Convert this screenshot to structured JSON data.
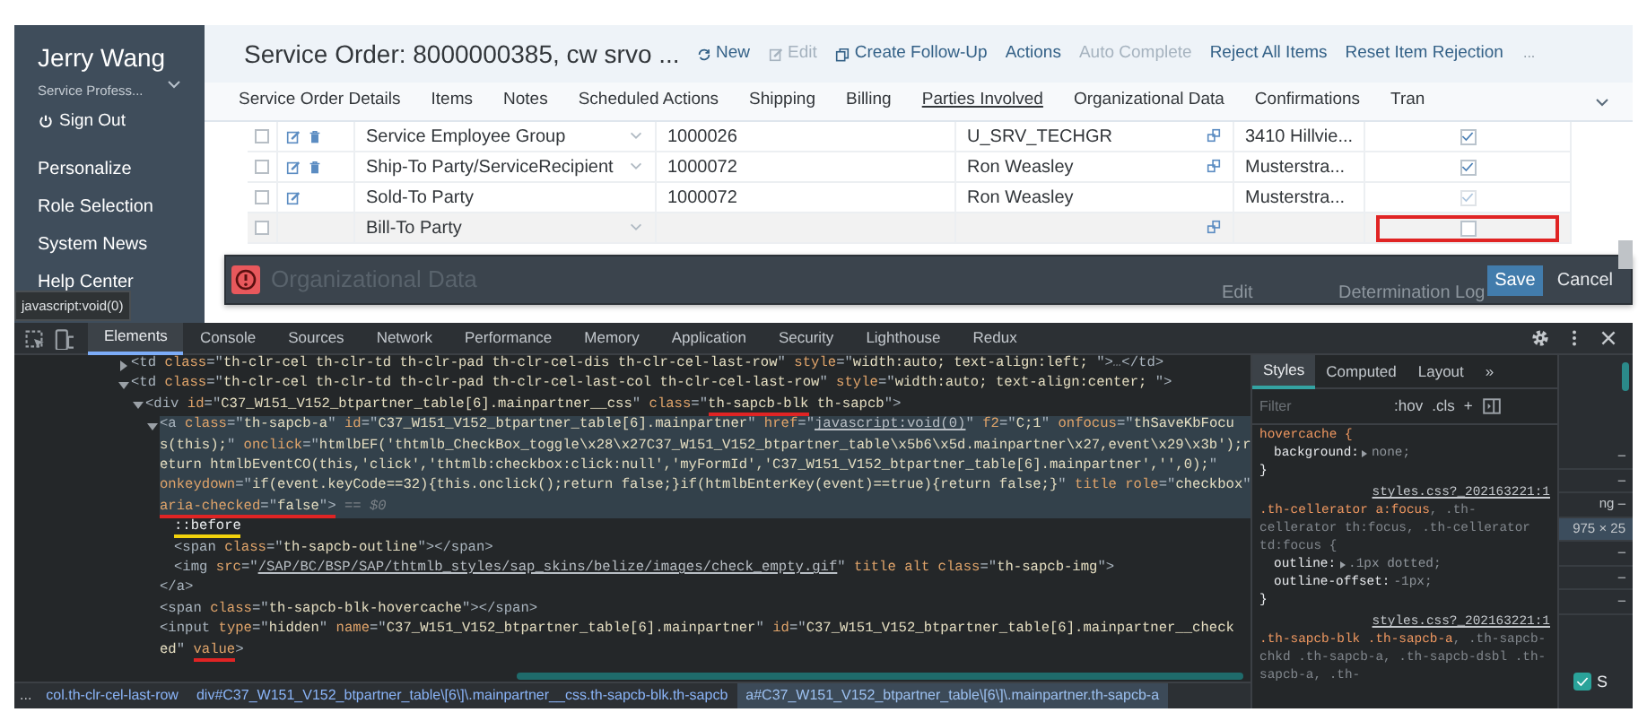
{
  "sidebar": {
    "user": "Jerry Wang",
    "role": "Service Profess...",
    "sign_out": "Sign Out",
    "items": [
      "Personalize",
      "Role Selection",
      "System News",
      "Help Center"
    ]
  },
  "tooltip": "javascript:void(0)",
  "header": {
    "title": "Service Order: 8000000385, cw srvo ...",
    "overflow": "...",
    "actions": [
      {
        "label": "New",
        "kind": "new",
        "disabled": false
      },
      {
        "label": "Edit",
        "kind": "edit",
        "disabled": true
      },
      {
        "label": "Create Follow-Up",
        "kind": "copy",
        "disabled": false
      },
      {
        "label": "Actions",
        "kind": "text",
        "disabled": false
      },
      {
        "label": "Auto Complete",
        "kind": "text",
        "disabled": true
      },
      {
        "label": "Reject All Items",
        "kind": "text",
        "disabled": false
      },
      {
        "label": "Reset Item Rejection",
        "kind": "text",
        "disabled": false
      }
    ]
  },
  "tabs": [
    {
      "label": "Service Order Details",
      "selected": false
    },
    {
      "label": "Items",
      "selected": false
    },
    {
      "label": "Notes",
      "selected": false
    },
    {
      "label": "Scheduled Actions",
      "selected": false
    },
    {
      "label": "Shipping",
      "selected": false
    },
    {
      "label": "Billing",
      "selected": false
    },
    {
      "label": "Parties Involved",
      "selected": true
    },
    {
      "label": "Organizational Data",
      "selected": false
    },
    {
      "label": "Confirmations",
      "selected": false
    },
    {
      "label": "Tran",
      "selected": false
    }
  ],
  "table": {
    "rows": [
      {
        "checked": false,
        "actions": [
          {
            "kind": "edit"
          },
          {
            "kind": "delete"
          }
        ],
        "function": "Service Employee Group",
        "editable": true,
        "partner": "1000026",
        "name": "U_SRV_TECHGR",
        "address": "3410 Hillvie...",
        "main": true,
        "selected": false,
        "annotated": false
      },
      {
        "checked": false,
        "actions": [
          {
            "kind": "edit"
          },
          {
            "kind": "delete"
          }
        ],
        "function": "Ship-To Party/ServiceRecipient",
        "editable": true,
        "partner": "1000072",
        "name": "Ron Weasley",
        "address": "Musterstra...",
        "main": true,
        "selected": false,
        "annotated": false
      },
      {
        "checked": false,
        "actions": [
          {
            "kind": "edit"
          }
        ],
        "function": "Sold-To Party",
        "editable": false,
        "partner": "1000072",
        "name": "Ron Weasley",
        "address": "Musterstra...",
        "main": true,
        "selected": false,
        "annotated": false
      },
      {
        "checked": false,
        "function": "Bill-To Party",
        "editable": true,
        "main": false,
        "selected": true,
        "annotated": true
      }
    ]
  },
  "message_bar": {
    "kind": "error",
    "behind": [
      "Organizational Data",
      "Edit",
      "Determination Log"
    ],
    "buttons": [
      {
        "label": "Save",
        "primary": true
      },
      {
        "label": "Cancel",
        "primary": false
      }
    ]
  },
  "devtools": {
    "tabs": [
      {
        "label": "Elements",
        "selected": true
      },
      {
        "label": "Console",
        "selected": false
      },
      {
        "label": "Sources",
        "selected": false
      },
      {
        "label": "Network",
        "selected": false
      },
      {
        "label": "Performance",
        "selected": false
      },
      {
        "label": "Memory",
        "selected": false
      },
      {
        "label": "Application",
        "selected": false
      },
      {
        "label": "Security",
        "selected": false
      },
      {
        "label": "Lighthouse",
        "selected": false
      },
      {
        "label": "Redux",
        "selected": false
      }
    ],
    "dom": [
      {
        "expanded": false,
        "selected": false,
        "lines": [
          [
            {
              "kind": "tag",
              "text": "<td "
            },
            {
              "kind": "attr",
              "text": "class"
            },
            {
              "kind": "tag",
              "text": "=\""
            },
            {
              "kind": "value",
              "text": "th-clr-cel th-clr-td th-clr-pad th-clr-cel-dis th-clr-cel-last-row"
            },
            {
              "kind": "tag",
              "text": "\" "
            },
            {
              "kind": "attr",
              "text": "style"
            },
            {
              "kind": "tag",
              "text": "=\""
            },
            {
              "kind": "value",
              "text": "width:auto; text-align:left; "
            },
            {
              "kind": "tag",
              "text": "\">"
            },
            {
              "kind": "text",
              "text": "…"
            },
            {
              "kind": "tag",
              "text": "</td>"
            }
          ]
        ]
      },
      {
        "expanded": true,
        "selected": false,
        "lines": [
          [
            {
              "kind": "tag",
              "text": "<td "
            },
            {
              "kind": "attr",
              "text": "class"
            },
            {
              "kind": "tag",
              "text": "=\""
            },
            {
              "kind": "value",
              "text": "th-clr-cel th-clr-td th-clr-pad th-clr-cel-last-col th-clr-cel-last-row"
            },
            {
              "kind": "tag",
              "text": "\" "
            },
            {
              "kind": "attr",
              "text": "style"
            },
            {
              "kind": "tag",
              "text": "=\""
            },
            {
              "kind": "value",
              "text": "width:auto; text-align:center; "
            },
            {
              "kind": "tag",
              "text": "\">"
            }
          ]
        ],
        "children": [
          {
            "expanded": true,
            "selected": false,
            "lines": [
              [
                {
                  "kind": "tag",
                  "text": "<div "
                },
                {
                  "kind": "attr",
                  "text": "id"
                },
                {
                  "kind": "tag",
                  "text": "=\""
                },
                {
                  "kind": "value",
                  "text": "C37_W151_V152_btpartner_table[6].mainpartner__css"
                },
                {
                  "kind": "tag",
                  "text": "\" "
                },
                {
                  "kind": "attr",
                  "text": "class"
                },
                {
                  "kind": "tag",
                  "text": "=\""
                },
                {
                  "kind": "value",
                  "text": "th-sapcb-blk",
                  "mark": {
                    "color": "#e02424"
                  }
                },
                {
                  "kind": "value",
                  "text": " th-sapcb"
                },
                {
                  "kind": "tag",
                  "text": "\">"
                }
              ]
            ],
            "children": [
              {
                "expanded": true,
                "selected": true,
                "lines": [
                  [
                    {
                      "kind": "tag",
                      "text": "<a "
                    },
                    {
                      "kind": "attr",
                      "text": "class"
                    },
                    {
                      "kind": "tag",
                      "text": "=\""
                    },
                    {
                      "kind": "value",
                      "text": "th-sapcb-a"
                    },
                    {
                      "kind": "tag",
                      "text": "\" "
                    },
                    {
                      "kind": "attr",
                      "text": "id"
                    },
                    {
                      "kind": "tag",
                      "text": "=\""
                    },
                    {
                      "kind": "value",
                      "text": "C37_W151_V152_btpartner_table[6].mainpartner"
                    },
                    {
                      "kind": "tag",
                      "text": "\" "
                    },
                    {
                      "kind": "attr",
                      "text": "href"
                    },
                    {
                      "kind": "tag",
                      "text": "=\""
                    },
                    {
                      "kind": "link",
                      "text": "javascript:void(0)"
                    },
                    {
                      "kind": "tag",
                      "text": "\" "
                    },
                    {
                      "kind": "attr",
                      "text": "f2"
                    },
                    {
                      "kind": "tag",
                      "text": "=\""
                    },
                    {
                      "kind": "value",
                      "text": "C;1"
                    },
                    {
                      "kind": "tag",
                      "text": "\" "
                    },
                    {
                      "kind": "attr",
                      "text": "onfocus"
                    },
                    {
                      "kind": "tag",
                      "text": "=\""
                    },
                    {
                      "kind": "value",
                      "text": "thSaveKbFocu"
                    }
                  ],
                  [
                    {
                      "kind": "value",
                      "text": "s(this);"
                    },
                    {
                      "kind": "tag",
                      "text": "\" "
                    },
                    {
                      "kind": "attr",
                      "text": "onclick"
                    },
                    {
                      "kind": "tag",
                      "text": "=\""
                    },
                    {
                      "kind": "value",
                      "text": "htmlbEF('thtmlb_CheckBox_toggle\\x28\\x27C37_W151_V152_btpartner_table\\x5b6\\x5d.mainpartner\\x27,event\\x29\\x3b');r"
                    }
                  ],
                  [
                    {
                      "kind": "value",
                      "text": "eturn htmlbEventCO(this,'click','thtmlb:checkbox:click:null','myFormId','C37_W151_V152_btpartner_table[6].mainpartner','',0);"
                    },
                    {
                      "kind": "tag",
                      "text": "\""
                    }
                  ],
                  [
                    {
                      "kind": "attr",
                      "text": "onkeydown"
                    },
                    {
                      "kind": "tag",
                      "text": "=\""
                    },
                    {
                      "kind": "value",
                      "text": "if(event.keyCode==32){this.onclick();return false;}if(htmlbEnterKey(event)==true){return false;}"
                    },
                    {
                      "kind": "tag",
                      "text": "\" "
                    },
                    {
                      "kind": "attr",
                      "text": "title role"
                    },
                    {
                      "kind": "tag",
                      "text": "=\""
                    },
                    {
                      "kind": "value",
                      "text": "checkbox"
                    },
                    {
                      "kind": "tag",
                      "text": "\""
                    }
                  ],
                  [
                    {
                      "kind": "attr",
                      "text": "aria-checked",
                      "mark": {
                        "color": "#e02424"
                      }
                    },
                    {
                      "kind": "tag",
                      "text": "=\"",
                      "mark": {
                        "color": "#e02424"
                      }
                    },
                    {
                      "kind": "value",
                      "text": "false",
                      "mark": {
                        "color": "#e02424"
                      }
                    },
                    {
                      "kind": "tag",
                      "text": "\">",
                      "mark": {
                        "color": "#e02424"
                      }
                    },
                    {
                      "kind": "text",
                      "text": " == $0"
                    }
                  ]
                ],
                "children": [
                  {
                    "lines": [
                      [
                        {
                          "kind": "pseudo",
                          "text": "::before",
                          "mark": {
                            "color": "#f2d20c"
                          }
                        }
                      ]
                    ]
                  },
                  {
                    "lines": [
                      [
                        {
                          "kind": "tag",
                          "text": "<span "
                        },
                        {
                          "kind": "attr",
                          "text": "class"
                        },
                        {
                          "kind": "tag",
                          "text": "=\""
                        },
                        {
                          "kind": "value",
                          "text": "th-sapcb-outline"
                        },
                        {
                          "kind": "tag",
                          "text": "\"></span>"
                        }
                      ]
                    ]
                  },
                  {
                    "lines": [
                      [
                        {
                          "kind": "tag",
                          "text": "<img "
                        },
                        {
                          "kind": "attr",
                          "text": "src"
                        },
                        {
                          "kind": "tag",
                          "text": "=\""
                        },
                        {
                          "kind": "link",
                          "text": "/SAP/BC/BSP/SAP/thtmlb_styles/sap_skins/belize/images/check_empty.gif"
                        },
                        {
                          "kind": "tag",
                          "text": "\" "
                        },
                        {
                          "kind": "attr",
                          "text": "title alt class"
                        },
                        {
                          "kind": "tag",
                          "text": "=\""
                        },
                        {
                          "kind": "value",
                          "text": "th-sapcb-img"
                        },
                        {
                          "kind": "tag",
                          "text": "\">"
                        }
                      ]
                    ]
                  }
                ],
                "close": [
                  [
                    {
                      "kind": "tag",
                      "text": "</a>"
                    }
                  ]
                ]
              },
              {
                "lines": [
                  [
                    {
                      "kind": "tag",
                      "text": "<span "
                    },
                    {
                      "kind": "attr",
                      "text": "class"
                    },
                    {
                      "kind": "tag",
                      "text": "=\""
                    },
                    {
                      "kind": "value",
                      "text": "th-sapcb-blk-hovercache"
                    },
                    {
                      "kind": "tag",
                      "text": "\"></span>"
                    }
                  ]
                ]
              },
              {
                "lines": [
                  [
                    {
                      "kind": "tag",
                      "text": "<input "
                    },
                    {
                      "kind": "attr",
                      "text": "type"
                    },
                    {
                      "kind": "tag",
                      "text": "=\""
                    },
                    {
                      "kind": "value",
                      "text": "hidden"
                    },
                    {
                      "kind": "tag",
                      "text": "\" "
                    },
                    {
                      "kind": "attr",
                      "text": "name"
                    },
                    {
                      "kind": "tag",
                      "text": "=\""
                    },
                    {
                      "kind": "value",
                      "text": "C37_W151_V152_btpartner_table[6].mainpartner"
                    },
                    {
                      "kind": "tag",
                      "text": "\" "
                    },
                    {
                      "kind": "attr",
                      "text": "id"
                    },
                    {
                      "kind": "tag",
                      "text": "=\""
                    },
                    {
                      "kind": "value",
                      "text": "C37_W151_V152_btpartner_table[6].mainpartner__check"
                    }
                  ],
                  [
                    {
                      "kind": "value",
                      "text": "ed"
                    },
                    {
                      "kind": "tag",
                      "text": "\" "
                    },
                    {
                      "kind": "attr",
                      "text": "value",
                      "mark": {
                        "color": "#e02424"
                      }
                    },
                    {
                      "kind": "tag",
                      "text": ">"
                    }
                  ]
                ]
              }
            ]
          }
        ]
      }
    ],
    "breadcrumbs": {
      "overflow": "...",
      "items": [
        {
          "text": "col.th-clr-cel-last-row",
          "selected": false
        },
        {
          "text": "div#C37_W151_V152_btpartner_table\\[6\\]\\.mainpartner__css.th-sapcb-blk.th-sapcb",
          "selected": false
        },
        {
          "text": "a#C37_W151_V152_btpartner_table\\[6\\]\\.mainpartner.th-sapcb-a",
          "selected": true
        }
      ]
    },
    "styles": {
      "tabs": [
        {
          "label": "Styles",
          "selected": true
        },
        {
          "label": "Computed",
          "selected": false
        },
        {
          "label": "Layout",
          "selected": false
        }
      ],
      "more": "»",
      "filter": {
        "placeholder": "Filter"
      },
      "buttons": [
        ":hov",
        ".cls",
        "+"
      ],
      "rules": [
        {
          "selector": [
            {
              "text": "hovercache {",
              "matched": true
            }
          ],
          "props": [
            {
              "name": "background:",
              "value": "none;",
              "expandable": true
            }
          ],
          "close": "}"
        },
        {
          "selector": [
            {
              "text": ".th-cellerator a:focus",
              "matched": true
            },
            {
              "text": ", .th-cellerator th:focus, .th-cellerator td:focus {",
              "matched": false
            }
          ],
          "source": "styles.css?_202163221:1",
          "props": [
            {
              "name": "outline:",
              "value": ".1px dotted;",
              "expandable": true
            },
            {
              "name": "outline-offset:",
              "value": "-1px;",
              "expandable": false
            }
          ],
          "close": "}"
        },
        {
          "selector": [
            {
              "text": ".th-sapcb-blk .th-sapcb-a",
              "matched": true
            },
            {
              "text": ", .th-sapcb-chkd .th-sapcb-a, .th-sapcb-dsbl .th-sapcb-a, .th-",
              "matched": false
            }
          ],
          "source": "styles.css?_202163221:1"
        }
      ]
    },
    "box_model": [
      {
        "text": "–",
        "selected": false
      },
      {
        "text": "–",
        "selected": false
      },
      {
        "text": "ng –",
        "selected": false
      },
      {
        "text": "975 × 25",
        "selected": true
      },
      {
        "text": "–",
        "selected": false
      },
      {
        "text": "–",
        "selected": false
      },
      {
        "text": "–",
        "selected": false
      }
    ],
    "show_all": {
      "label": "S",
      "checked": true
    }
  }
}
